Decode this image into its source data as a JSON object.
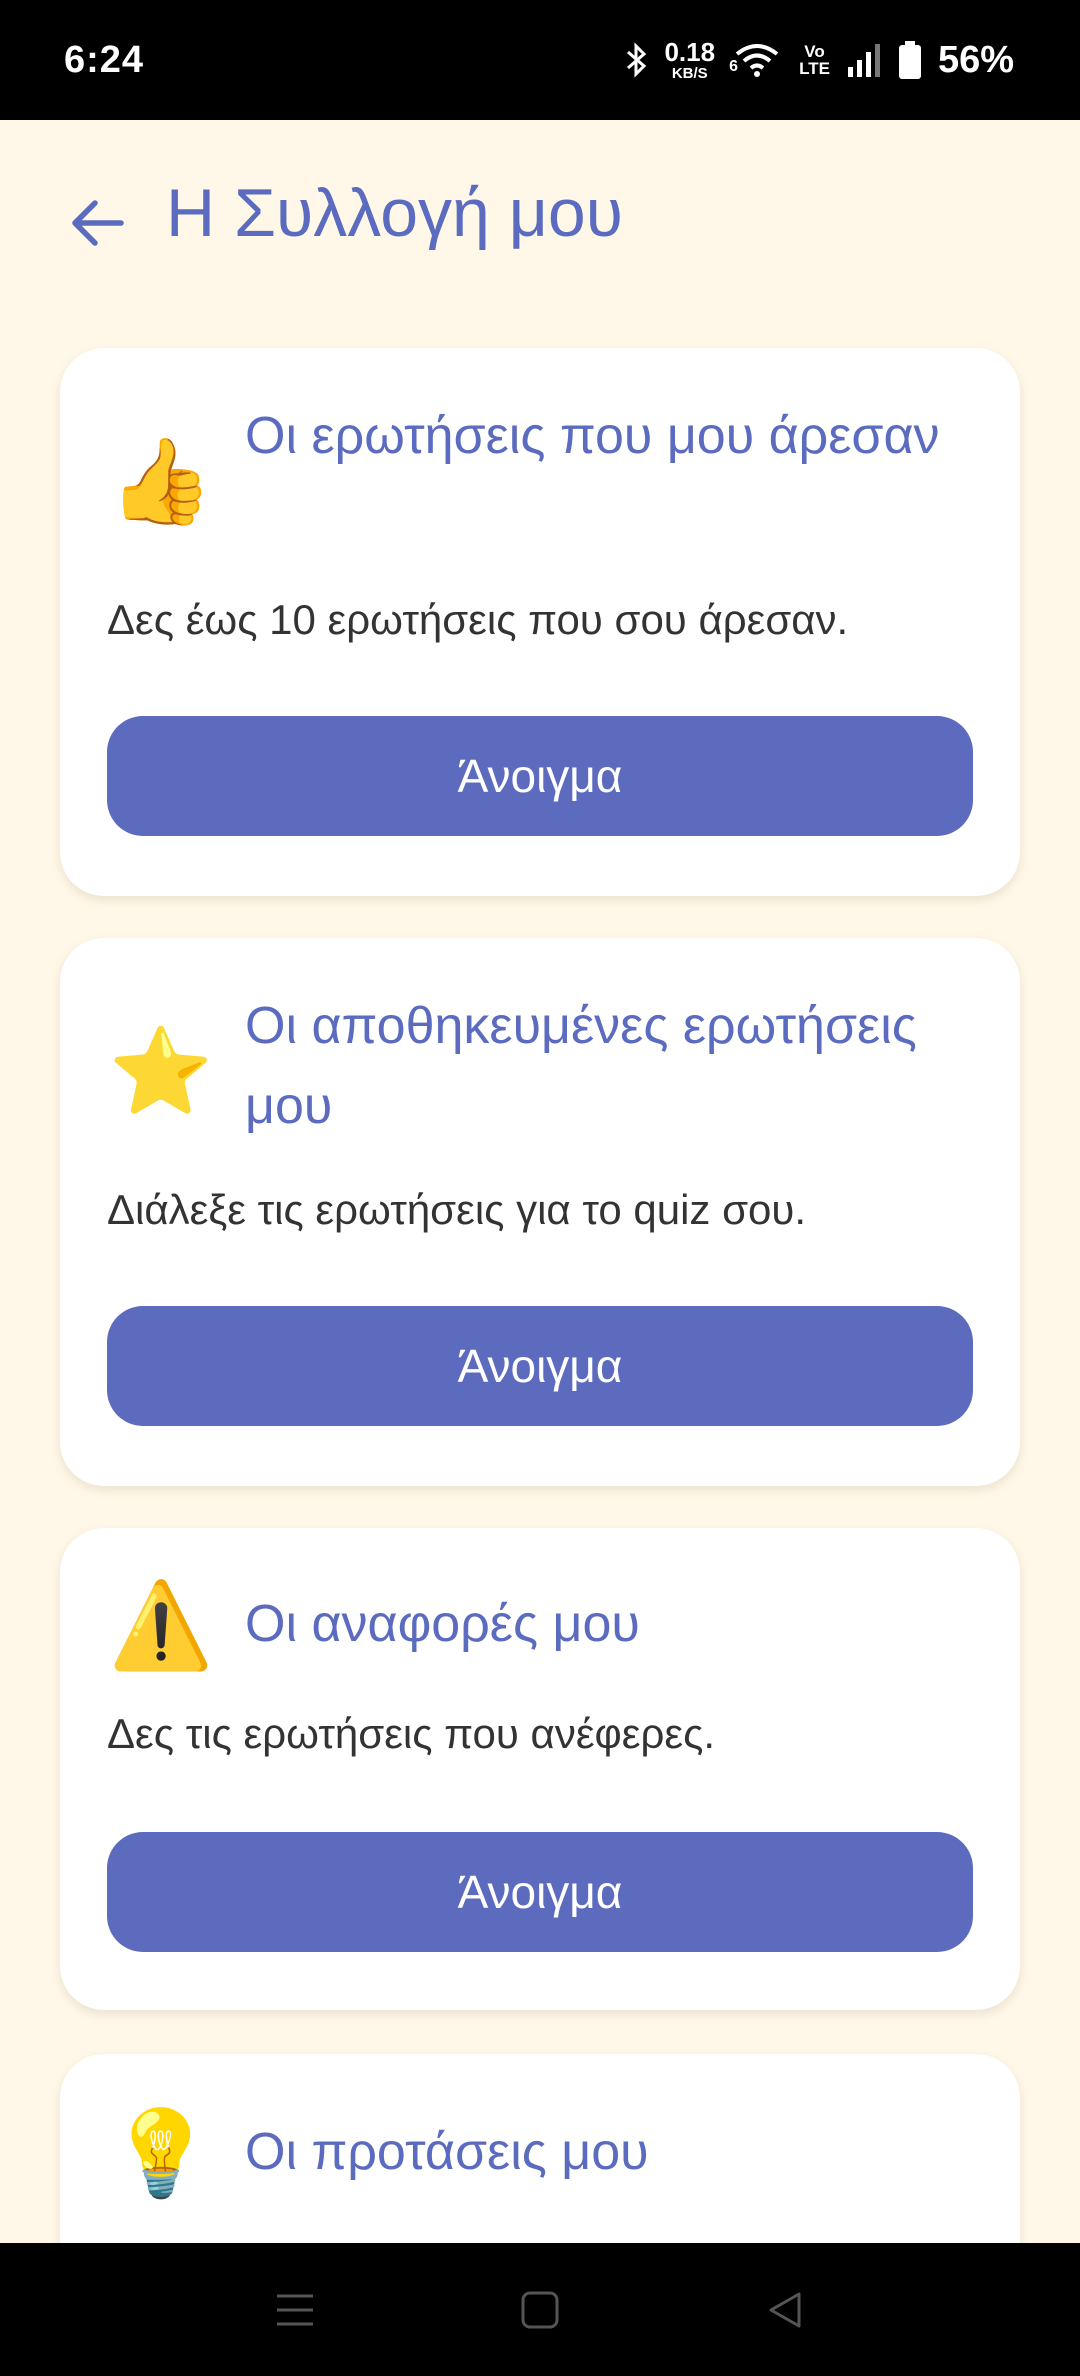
{
  "status_bar": {
    "time": "6:24",
    "net_speed_value": "0.18",
    "net_speed_unit": "KB/S",
    "wifi_label": "6",
    "volte_top": "Vo",
    "volte_bottom": "LTE",
    "battery_percent": "56%"
  },
  "header": {
    "title": "Η Συλλογή μου",
    "back_icon": "arrow-left-icon"
  },
  "cards": [
    {
      "icon": "thumbs-up-icon",
      "emoji": "👍",
      "title": "Οι ερωτήσεις που μου άρεσαν",
      "description": "Δες έως 10 ερωτήσεις που σου άρεσαν.",
      "button_label": "Άνοιγμα"
    },
    {
      "icon": "star-icon",
      "emoji": "⭐",
      "title": "Οι αποθηκευμένες ερωτήσεις μου",
      "description": "Διάλεξε τις ερωτήσεις για το quiz σου.",
      "button_label": "Άνοιγμα"
    },
    {
      "icon": "warning-icon",
      "emoji": "⚠️",
      "title": "Οι αναφορές μου",
      "description": "Δες τις ερωτήσεις που ανέφερες.",
      "button_label": "Άνοιγμα"
    },
    {
      "icon": "light-bulb-icon",
      "emoji": "💡",
      "title": "Οι προτάσεις μου",
      "description": "",
      "button_label": ""
    }
  ],
  "colors": {
    "background": "#FFF8E8",
    "accent": "#5B6BBF",
    "button": "#5D6BBF",
    "card": "#FFFFFF"
  }
}
